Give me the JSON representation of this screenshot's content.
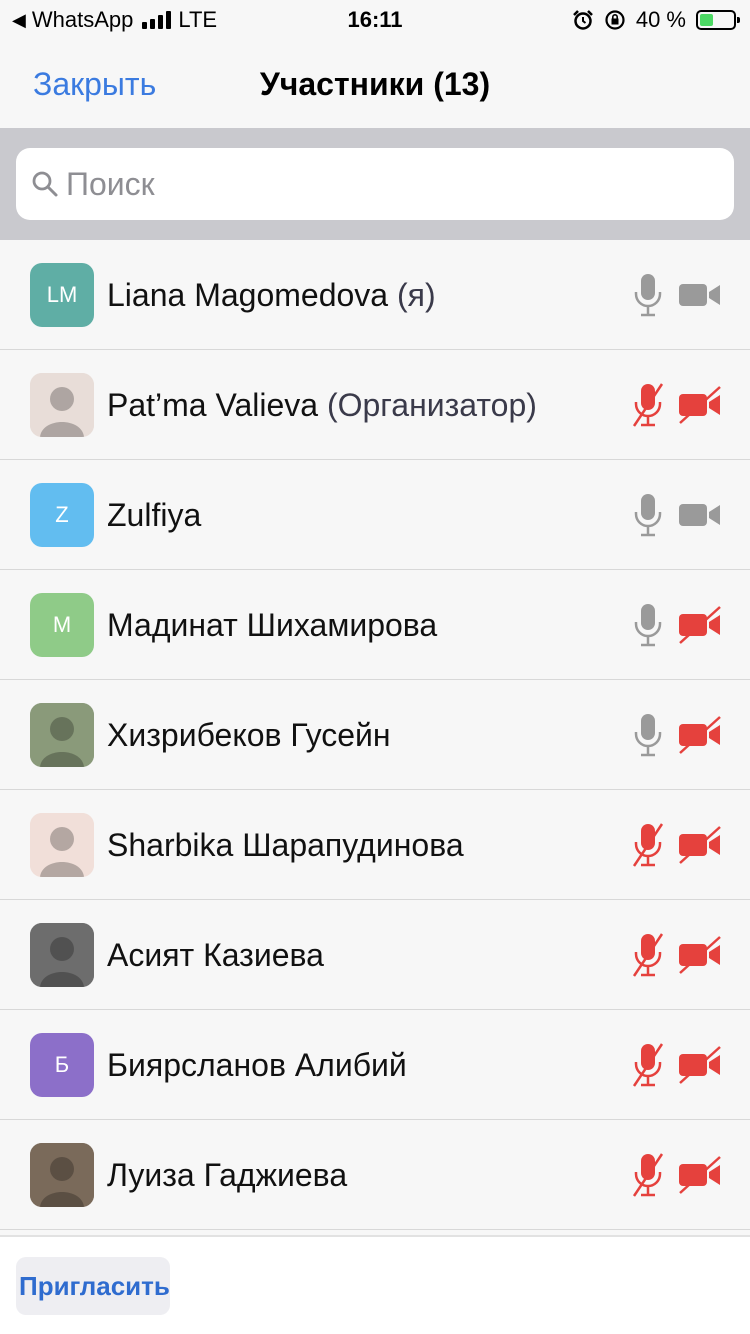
{
  "status_bar": {
    "back_app": "WhatsApp",
    "network": "LTE",
    "time": "16:11",
    "battery_text": "40 %",
    "battery_level": 0.4
  },
  "nav": {
    "close_label": "Закрыть",
    "title": "Участники (13)"
  },
  "search": {
    "placeholder": "Поиск"
  },
  "participants": [
    {
      "name": "Liana Magomedova",
      "suffix": "(я)",
      "initials": "LM",
      "avatar_color": "#5faea5",
      "mic": "on",
      "cam": "on"
    },
    {
      "name": "Pat’ma Valieva",
      "suffix": "(Организатор)",
      "initials": "",
      "avatar_color": "#e8ddd8",
      "mic": "off",
      "cam": "off"
    },
    {
      "name": "Zulfiya",
      "suffix": "",
      "initials": "Z",
      "avatar_color": "#62bdf0",
      "mic": "on",
      "cam": "on"
    },
    {
      "name": "Мадинат Шихамирова",
      "suffix": "",
      "initials": "М",
      "avatar_color": "#8fcb88",
      "mic": "on",
      "cam": "off"
    },
    {
      "name": "Хизрибеков Гусейн",
      "suffix": "",
      "initials": "",
      "avatar_color": "#8a9a7a",
      "mic": "on",
      "cam": "off"
    },
    {
      "name": "Sharbika Шарапудинова",
      "suffix": "",
      "initials": "",
      "avatar_color": "#f1dfd9",
      "mic": "off",
      "cam": "off"
    },
    {
      "name": "Асият Казиева",
      "suffix": "",
      "initials": "",
      "avatar_color": "#6d6d6d",
      "mic": "off",
      "cam": "off"
    },
    {
      "name": "Биярсланов Алибий",
      "suffix": "",
      "initials": "Б",
      "avatar_color": "#8c6fc9",
      "mic": "off",
      "cam": "off"
    },
    {
      "name": "Луиза Гаджиева",
      "suffix": "",
      "initials": "",
      "avatar_color": "#7a6a5a",
      "mic": "off",
      "cam": "off"
    }
  ],
  "footer": {
    "invite_label": "Пригласить"
  },
  "colors": {
    "accent": "#3b7be0",
    "icon_on": "#9a9a9a",
    "icon_off": "#e5413d"
  }
}
